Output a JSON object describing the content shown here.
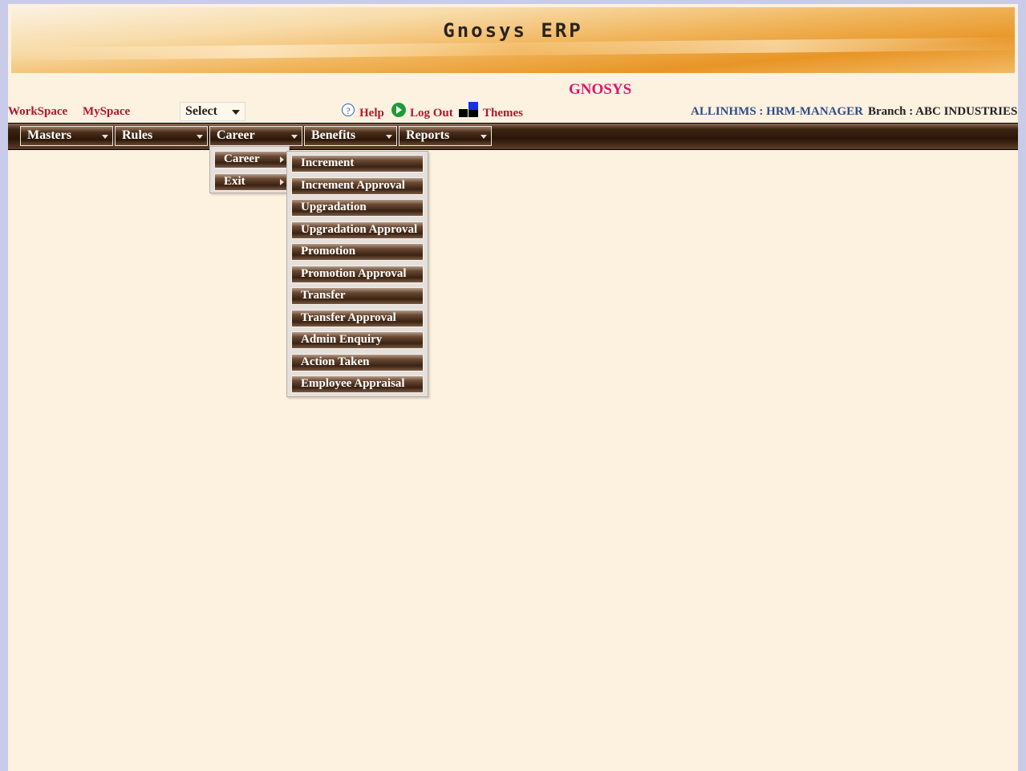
{
  "banner": {
    "title": "Gnosys ERP"
  },
  "brand": "GNOSYS",
  "top_links": {
    "workspace": "WorkSpace",
    "myspace": "MySpace"
  },
  "select": {
    "value": "Select"
  },
  "actions": {
    "help": "Help",
    "logout": "Log Out",
    "themes": "Themes"
  },
  "user_info": "ALLINHMS : HRM-MANAGER",
  "branch": "Branch : ABC INDUSTRIES",
  "menubar": {
    "items": [
      {
        "label": "Masters"
      },
      {
        "label": "Rules"
      },
      {
        "label": "Career"
      },
      {
        "label": "Benefits"
      },
      {
        "label": "Reports"
      }
    ]
  },
  "career_menu": {
    "items": [
      {
        "label": "Career"
      },
      {
        "label": "Exit"
      }
    ]
  },
  "career_submenu": {
    "items": [
      {
        "label": "Increment"
      },
      {
        "label": "Increment Approval"
      },
      {
        "label": "Upgradation"
      },
      {
        "label": "Upgradation Approval"
      },
      {
        "label": "Promotion"
      },
      {
        "label": "Promotion Approval"
      },
      {
        "label": "Transfer"
      },
      {
        "label": "Transfer Approval"
      },
      {
        "label": "Admin Enquiry"
      },
      {
        "label": "Action Taken"
      },
      {
        "label": "Employee Appraisal"
      }
    ]
  },
  "icons": {
    "help": "help-icon",
    "logout": "logout-icon",
    "themes": "themes-icon"
  },
  "colors": {
    "brand": "#e0136f",
    "links": "#b0182a",
    "user_info": "#2f4c8a",
    "page_bg": "#fdf1e0",
    "menubar": "#2a1608"
  }
}
